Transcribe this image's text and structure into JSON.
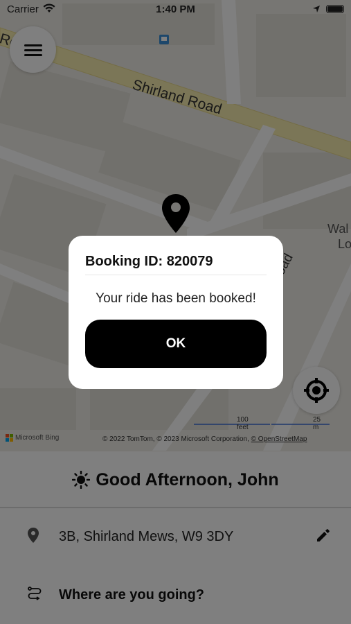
{
  "status_bar": {
    "carrier": "Carrier",
    "time": "1:40 PM"
  },
  "map": {
    "street_labels": [
      "Shirland Road",
      "Ro",
      "Road",
      "Wal",
      "Lo"
    ],
    "scale": {
      "feet": "100 feet",
      "meters": "25 m"
    },
    "bing_label": "Microsoft Bing",
    "copyright": "© 2022 TomTom, © 2023 Microsoft Corporation, ",
    "osm_link": "© OpenStreetMap"
  },
  "dialog": {
    "title": "Booking ID: 820079",
    "message": "Your ride has been booked!",
    "ok_label": "OK"
  },
  "panel": {
    "greeting": "Good Afternoon, John",
    "pickup_address": "3B, Shirland Mews, W9 3DY",
    "destination_prompt": "Where are you going?"
  },
  "icons": [
    "wifi-icon",
    "location-arrow-icon",
    "battery-icon",
    "menu-icon",
    "map-pin-icon",
    "locate-icon",
    "sun-icon",
    "location-pin-icon",
    "edit-icon",
    "route-icon"
  ]
}
